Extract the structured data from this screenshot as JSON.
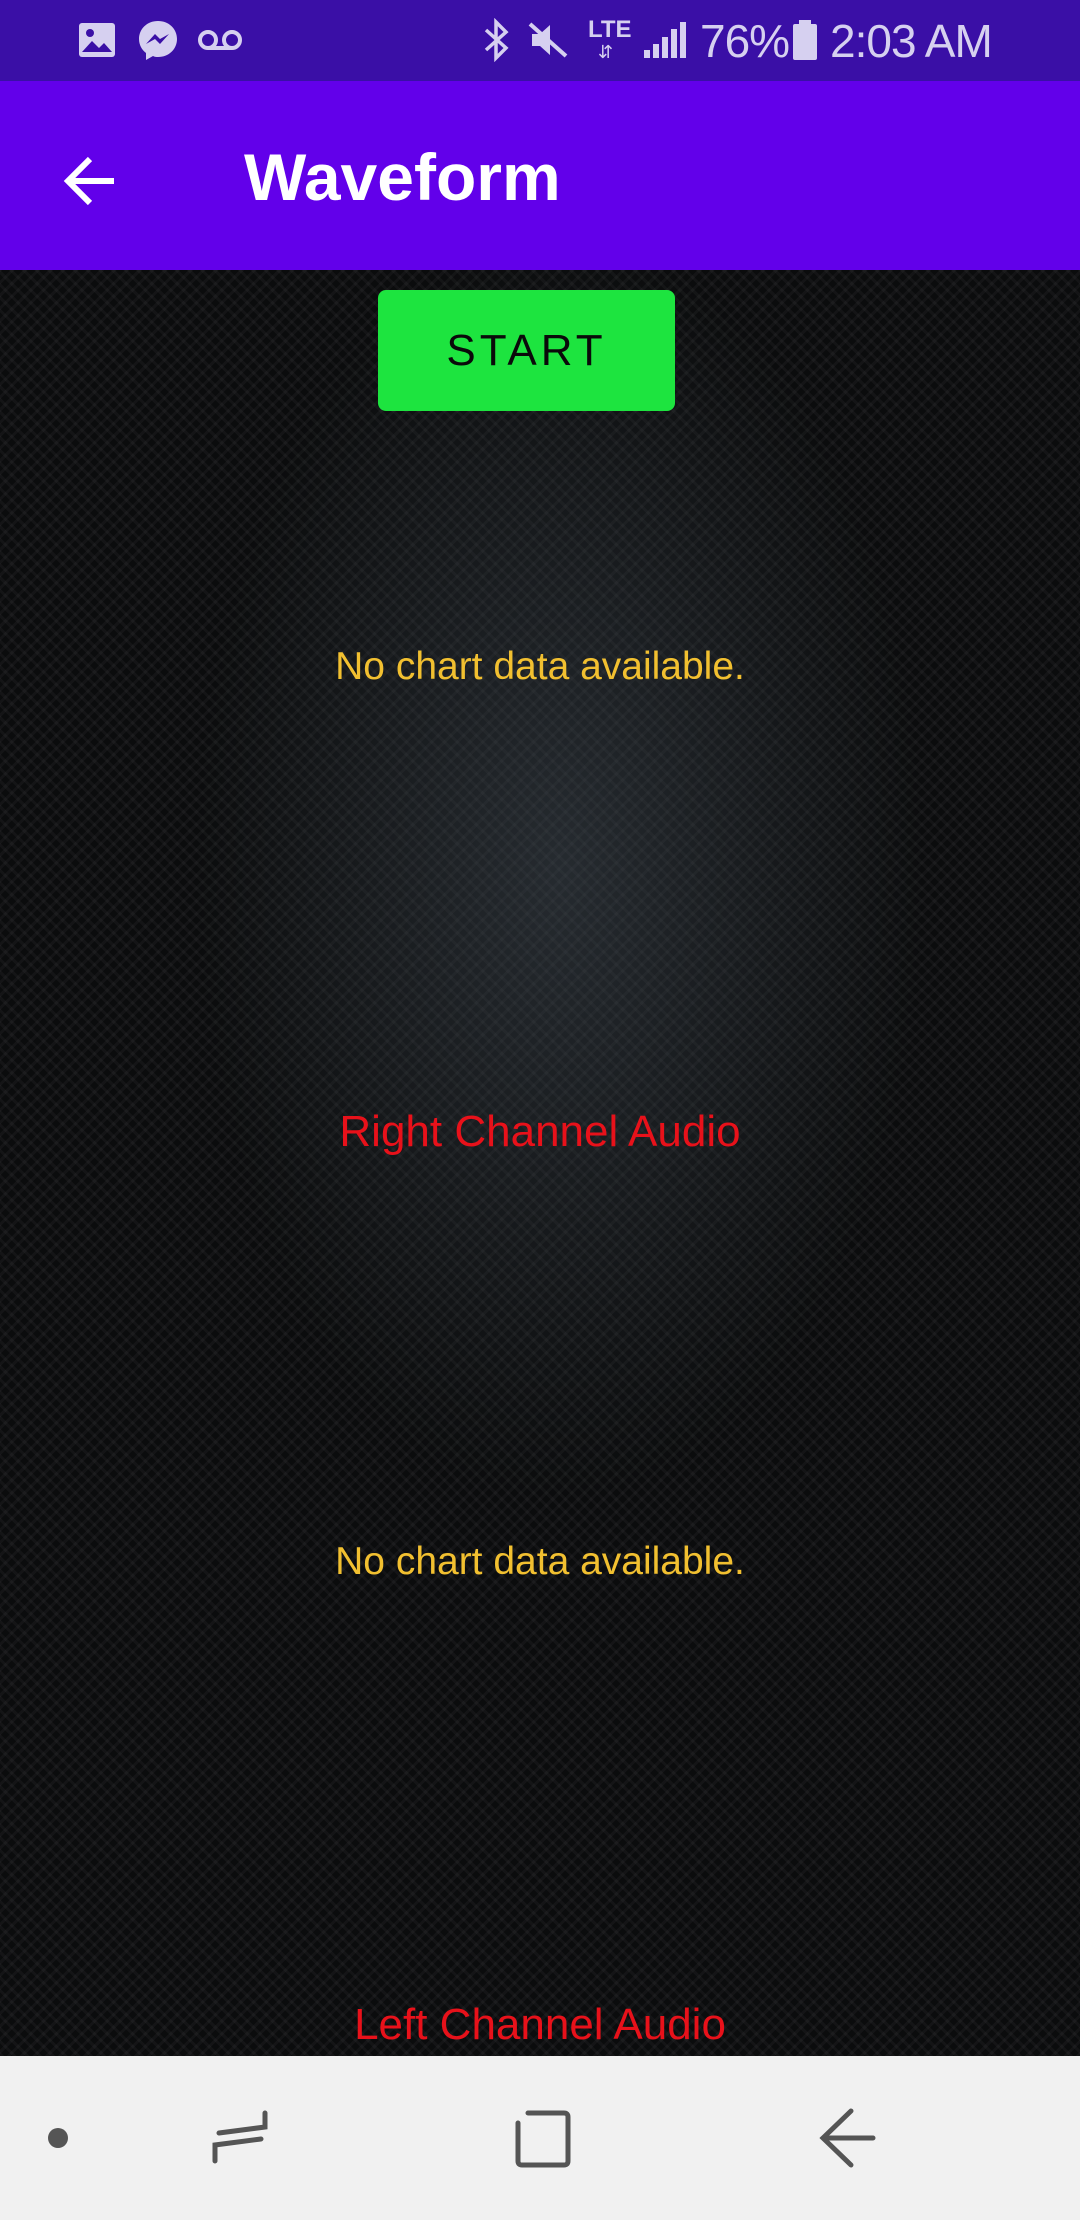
{
  "status_bar": {
    "battery_percent": "76%",
    "time": "2:03 AM",
    "icons": [
      "gallery-icon",
      "messenger-icon",
      "voicemail-icon",
      "bluetooth-icon",
      "mute-icon",
      "lte-icon",
      "signal-icon",
      "battery-icon"
    ],
    "lte_label": "LTE"
  },
  "app_bar": {
    "title": "Waveform",
    "background": "#6200ea"
  },
  "controls": {
    "start_label": "START",
    "start_color": "#1de43f"
  },
  "charts": [
    {
      "empty_text": "No chart data available.",
      "label": "Right Channel Audio"
    },
    {
      "empty_text": "No chart data available.",
      "label": "Left Channel Audio"
    }
  ],
  "colors": {
    "empty_text": "#f2c030",
    "channel_label": "#e8111a"
  },
  "nav_bar": {
    "icons": [
      "dot-icon",
      "recents-icon",
      "home-icon",
      "back-icon"
    ]
  }
}
